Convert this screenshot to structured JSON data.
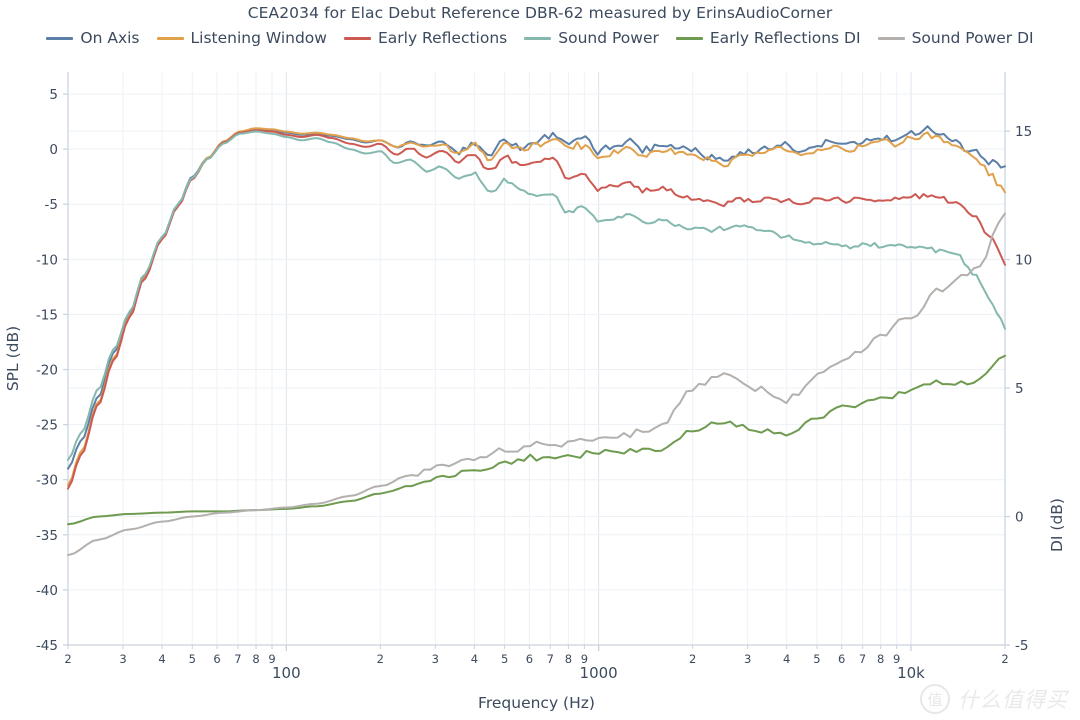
{
  "chart_data": {
    "type": "line",
    "title": "CEA2034 for Elac Debut Reference DBR-62 measured by ErinsAudioCorner",
    "xlabel": "Frequency (Hz)",
    "ylabel": "SPL (dB)",
    "y2label": "DI (dB)",
    "xscale": "log",
    "xlim": [
      20,
      20000
    ],
    "ylim": [
      -45,
      7
    ],
    "y2lim": [
      -5,
      17.3
    ],
    "grid": true,
    "legend_position": "top-center",
    "yticks": [
      5,
      0,
      -5,
      -10,
      -15,
      -20,
      -25,
      -30,
      -35,
      -40,
      -45
    ],
    "y2ticks": [
      15,
      10,
      5,
      0,
      -5
    ],
    "xtick_major": [
      {
        "value": 100,
        "label": "100"
      },
      {
        "value": 1000,
        "label": "1000"
      },
      {
        "value": 10000,
        "label": "10k"
      }
    ],
    "xtick_minor": [
      {
        "value": 20,
        "label": "2"
      },
      {
        "value": 30,
        "label": "3"
      },
      {
        "value": 40,
        "label": "4"
      },
      {
        "value": 50,
        "label": "5"
      },
      {
        "value": 60,
        "label": "6"
      },
      {
        "value": 70,
        "label": "7"
      },
      {
        "value": 80,
        "label": "8"
      },
      {
        "value": 90,
        "label": "9"
      },
      {
        "value": 200,
        "label": "2"
      },
      {
        "value": 300,
        "label": "3"
      },
      {
        "value": 400,
        "label": "4"
      },
      {
        "value": 500,
        "label": "5"
      },
      {
        "value": 600,
        "label": "6"
      },
      {
        "value": 700,
        "label": "7"
      },
      {
        "value": 800,
        "label": "8"
      },
      {
        "value": 900,
        "label": "9"
      },
      {
        "value": 2000,
        "label": "2"
      },
      {
        "value": 3000,
        "label": "3"
      },
      {
        "value": 4000,
        "label": "4"
      },
      {
        "value": 5000,
        "label": "5"
      },
      {
        "value": 6000,
        "label": "6"
      },
      {
        "value": 7000,
        "label": "7"
      },
      {
        "value": 8000,
        "label": "8"
      },
      {
        "value": 9000,
        "label": "9"
      },
      {
        "value": 20000,
        "label": "2"
      }
    ],
    "series": [
      {
        "name": "On Axis",
        "color": "#5b7fa6",
        "axis": "left",
        "x": [
          20,
          22,
          25,
          28,
          31.5,
          35,
          40,
          45,
          50,
          56,
          63,
          71,
          80,
          90,
          100,
          112,
          125,
          140,
          160,
          180,
          200,
          224,
          250,
          280,
          315,
          355,
          400,
          450,
          500,
          560,
          630,
          710,
          800,
          900,
          1000,
          1120,
          1250,
          1400,
          1600,
          1800,
          2000,
          2240,
          2500,
          2800,
          3150,
          3550,
          4000,
          4500,
          5000,
          5600,
          6300,
          7100,
          8000,
          9000,
          10000,
          11200,
          12500,
          14000,
          16000,
          18000,
          20000
        ],
        "y": [
          -29.0,
          -26.5,
          -22.5,
          -18.5,
          -15.0,
          -11.5,
          -8.0,
          -5.0,
          -2.5,
          -0.8,
          0.6,
          1.5,
          1.8,
          1.7,
          1.5,
          1.3,
          1.4,
          1.2,
          0.9,
          0.6,
          0.8,
          0.2,
          0.6,
          0.3,
          0.6,
          -0.3,
          0.5,
          -0.4,
          0.9,
          0.1,
          0.7,
          1.4,
          0.6,
          0.9,
          -0.2,
          0.3,
          0.8,
          -0.1,
          0.5,
          0.2,
          0.0,
          -0.6,
          -1.0,
          -0.4,
          -0.2,
          0.1,
          0.5,
          -0.2,
          0.3,
          0.6,
          0.4,
          0.7,
          0.9,
          0.7,
          1.4,
          2.0,
          1.3,
          0.5,
          -0.3,
          -1.1,
          -1.6
        ]
      },
      {
        "name": "Listening Window",
        "color": "#e0a14c",
        "axis": "left",
        "x": [
          20,
          22,
          25,
          28,
          31.5,
          35,
          40,
          45,
          50,
          56,
          63,
          71,
          80,
          90,
          100,
          112,
          125,
          140,
          160,
          180,
          200,
          224,
          250,
          280,
          315,
          355,
          400,
          450,
          500,
          560,
          630,
          710,
          800,
          900,
          1000,
          1120,
          1250,
          1400,
          1600,
          1800,
          2000,
          2240,
          2500,
          2800,
          3150,
          3550,
          4000,
          4500,
          5000,
          5600,
          6300,
          7100,
          8000,
          9000,
          10000,
          11200,
          12500,
          14000,
          16000,
          18000,
          20000
        ],
        "y": [
          -30.5,
          -27.5,
          -23.0,
          -19.0,
          -15.2,
          -11.7,
          -8.1,
          -5.1,
          -2.6,
          -0.8,
          0.7,
          1.6,
          1.9,
          1.8,
          1.6,
          1.4,
          1.5,
          1.3,
          1.0,
          0.7,
          0.8,
          0.2,
          0.6,
          0.2,
          0.5,
          -0.4,
          0.4,
          -1.0,
          0.5,
          -0.2,
          0.3,
          1.0,
          0.2,
          0.4,
          -0.7,
          -0.2,
          0.2,
          -0.6,
          0.0,
          -0.3,
          -0.5,
          -1.0,
          -1.4,
          -0.7,
          -0.5,
          -0.2,
          0.0,
          -0.6,
          -0.2,
          0.1,
          0.0,
          0.4,
          0.7,
          0.5,
          1.0,
          1.3,
          1.0,
          0.3,
          -0.8,
          -2.3,
          -3.9
        ]
      },
      {
        "name": "Early Reflections",
        "color": "#cc5a52",
        "axis": "left",
        "x": [
          20,
          22,
          25,
          28,
          31.5,
          35,
          40,
          45,
          50,
          56,
          63,
          71,
          80,
          90,
          100,
          112,
          125,
          140,
          160,
          180,
          200,
          224,
          250,
          280,
          315,
          355,
          400,
          450,
          500,
          560,
          630,
          710,
          800,
          900,
          1000,
          1120,
          1250,
          1400,
          1600,
          1800,
          2000,
          2240,
          2500,
          2800,
          3150,
          3550,
          4000,
          4500,
          5000,
          5600,
          6300,
          7100,
          8000,
          9000,
          10000,
          11200,
          12500,
          14000,
          16000,
          18000,
          20000
        ],
        "y": [
          -30.8,
          -27.8,
          -23.2,
          -19.2,
          -15.3,
          -11.8,
          -8.2,
          -5.2,
          -2.7,
          -0.9,
          0.6,
          1.5,
          1.7,
          1.6,
          1.3,
          1.1,
          1.3,
          1.0,
          0.5,
          0.2,
          0.5,
          -0.5,
          0.1,
          -0.7,
          -0.2,
          -1.2,
          -0.4,
          -2.0,
          -0.6,
          -1.4,
          -1.1,
          -0.7,
          -2.6,
          -2.2,
          -3.6,
          -3.3,
          -3.0,
          -3.8,
          -3.4,
          -4.2,
          -4.5,
          -4.8,
          -5.0,
          -4.6,
          -4.8,
          -4.6,
          -4.5,
          -4.9,
          -4.7,
          -4.5,
          -4.6,
          -4.5,
          -4.7,
          -4.5,
          -4.3,
          -4.2,
          -4.4,
          -4.8,
          -6.0,
          -8.0,
          -10.2
        ]
      },
      {
        "name": "Sound Power",
        "color": "#85b8ae",
        "axis": "left",
        "x": [
          20,
          22,
          25,
          28,
          31.5,
          35,
          40,
          45,
          50,
          56,
          63,
          71,
          80,
          90,
          100,
          112,
          125,
          140,
          160,
          180,
          200,
          224,
          250,
          280,
          315,
          355,
          400,
          450,
          500,
          560,
          630,
          710,
          800,
          900,
          1000,
          1120,
          1250,
          1400,
          1600,
          1800,
          2000,
          2240,
          2500,
          2800,
          3150,
          3550,
          4000,
          4500,
          5000,
          5600,
          6300,
          7100,
          8000,
          9000,
          10000,
          11200,
          12500,
          14000,
          16000,
          18000,
          20000
        ],
        "y": [
          -28.2,
          -25.8,
          -21.8,
          -18.2,
          -14.8,
          -11.4,
          -8.0,
          -5.0,
          -2.6,
          -0.9,
          0.5,
          1.4,
          1.6,
          1.4,
          1.1,
          0.8,
          1.0,
          0.6,
          0.0,
          -0.4,
          -0.2,
          -1.3,
          -0.9,
          -2.0,
          -1.6,
          -2.6,
          -2.2,
          -3.9,
          -2.8,
          -3.6,
          -4.2,
          -4.1,
          -5.8,
          -5.2,
          -6.6,
          -6.3,
          -6.0,
          -6.7,
          -6.4,
          -7.0,
          -7.3,
          -7.3,
          -7.2,
          -7.0,
          -7.2,
          -7.5,
          -8.0,
          -8.4,
          -8.6,
          -8.6,
          -8.9,
          -8.7,
          -8.8,
          -8.6,
          -8.8,
          -9.0,
          -9.2,
          -9.6,
          -11.5,
          -13.8,
          -16.1
        ]
      },
      {
        "name": "Early Reflections DI",
        "color": "#6e9b4f",
        "axis": "right",
        "x": [
          20,
          25,
          31.5,
          40,
          50,
          63,
          80,
          100,
          125,
          160,
          200,
          250,
          315,
          400,
          500,
          630,
          800,
          1000,
          1250,
          1600,
          2000,
          2500,
          3150,
          4000,
          5000,
          6300,
          8000,
          10000,
          12500,
          16000,
          20000
        ],
        "y": [
          -0.3,
          0.0,
          0.1,
          0.15,
          0.2,
          0.2,
          0.25,
          0.3,
          0.4,
          0.6,
          0.9,
          1.2,
          1.5,
          1.8,
          2.1,
          2.3,
          2.4,
          2.5,
          2.6,
          2.7,
          3.3,
          3.7,
          3.4,
          3.2,
          3.8,
          4.3,
          4.6,
          4.9,
          5.2,
          5.3,
          6.2
        ]
      },
      {
        "name": "Sound Power DI",
        "color": "#b3b0ae",
        "axis": "right",
        "x": [
          20,
          25,
          31.5,
          40,
          50,
          63,
          80,
          100,
          125,
          160,
          200,
          250,
          315,
          400,
          500,
          630,
          800,
          1000,
          1250,
          1600,
          2000,
          2500,
          3150,
          4000,
          5000,
          6300,
          8000,
          10000,
          12500,
          16000,
          20000
        ],
        "y": [
          -1.5,
          -0.9,
          -0.5,
          -0.2,
          0.0,
          0.15,
          0.25,
          0.35,
          0.5,
          0.8,
          1.2,
          1.6,
          2.0,
          2.3,
          2.6,
          2.8,
          2.9,
          3.0,
          3.2,
          3.6,
          5.0,
          5.5,
          5.0,
          4.5,
          5.4,
          6.3,
          7.0,
          7.8,
          8.9,
          9.6,
          11.8
        ]
      }
    ]
  },
  "legend": [
    {
      "label": "On Axis",
      "color": "#5b7fa6"
    },
    {
      "label": "Listening Window",
      "color": "#e0a14c"
    },
    {
      "label": "Early Reflections",
      "color": "#cc5a52"
    },
    {
      "label": "Sound Power",
      "color": "#85b8ae"
    },
    {
      "label": "Early Reflections DI",
      "color": "#6e9b4f"
    },
    {
      "label": "Sound Power DI",
      "color": "#b3b0ae"
    }
  ],
  "watermark": {
    "mark": "值",
    "text": "什么值得买"
  }
}
